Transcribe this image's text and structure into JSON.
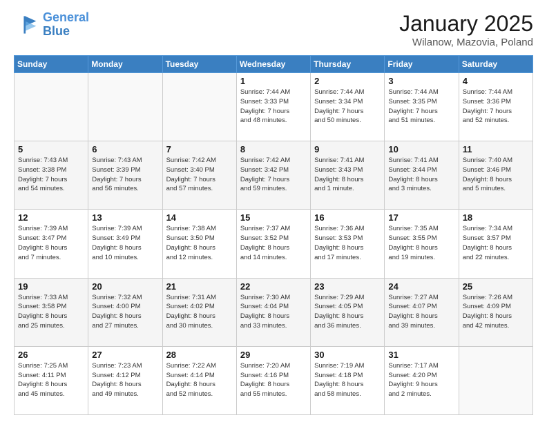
{
  "logo": {
    "line1": "General",
    "line2": "Blue"
  },
  "title": "January 2025",
  "subtitle": "Wilanow, Mazovia, Poland",
  "weekdays": [
    "Sunday",
    "Monday",
    "Tuesday",
    "Wednesday",
    "Thursday",
    "Friday",
    "Saturday"
  ],
  "weeks": [
    [
      {
        "day": "",
        "info": ""
      },
      {
        "day": "",
        "info": ""
      },
      {
        "day": "",
        "info": ""
      },
      {
        "day": "1",
        "info": "Sunrise: 7:44 AM\nSunset: 3:33 PM\nDaylight: 7 hours\nand 48 minutes."
      },
      {
        "day": "2",
        "info": "Sunrise: 7:44 AM\nSunset: 3:34 PM\nDaylight: 7 hours\nand 50 minutes."
      },
      {
        "day": "3",
        "info": "Sunrise: 7:44 AM\nSunset: 3:35 PM\nDaylight: 7 hours\nand 51 minutes."
      },
      {
        "day": "4",
        "info": "Sunrise: 7:44 AM\nSunset: 3:36 PM\nDaylight: 7 hours\nand 52 minutes."
      }
    ],
    [
      {
        "day": "5",
        "info": "Sunrise: 7:43 AM\nSunset: 3:38 PM\nDaylight: 7 hours\nand 54 minutes."
      },
      {
        "day": "6",
        "info": "Sunrise: 7:43 AM\nSunset: 3:39 PM\nDaylight: 7 hours\nand 56 minutes."
      },
      {
        "day": "7",
        "info": "Sunrise: 7:42 AM\nSunset: 3:40 PM\nDaylight: 7 hours\nand 57 minutes."
      },
      {
        "day": "8",
        "info": "Sunrise: 7:42 AM\nSunset: 3:42 PM\nDaylight: 7 hours\nand 59 minutes."
      },
      {
        "day": "9",
        "info": "Sunrise: 7:41 AM\nSunset: 3:43 PM\nDaylight: 8 hours\nand 1 minute."
      },
      {
        "day": "10",
        "info": "Sunrise: 7:41 AM\nSunset: 3:44 PM\nDaylight: 8 hours\nand 3 minutes."
      },
      {
        "day": "11",
        "info": "Sunrise: 7:40 AM\nSunset: 3:46 PM\nDaylight: 8 hours\nand 5 minutes."
      }
    ],
    [
      {
        "day": "12",
        "info": "Sunrise: 7:39 AM\nSunset: 3:47 PM\nDaylight: 8 hours\nand 7 minutes."
      },
      {
        "day": "13",
        "info": "Sunrise: 7:39 AM\nSunset: 3:49 PM\nDaylight: 8 hours\nand 10 minutes."
      },
      {
        "day": "14",
        "info": "Sunrise: 7:38 AM\nSunset: 3:50 PM\nDaylight: 8 hours\nand 12 minutes."
      },
      {
        "day": "15",
        "info": "Sunrise: 7:37 AM\nSunset: 3:52 PM\nDaylight: 8 hours\nand 14 minutes."
      },
      {
        "day": "16",
        "info": "Sunrise: 7:36 AM\nSunset: 3:53 PM\nDaylight: 8 hours\nand 17 minutes."
      },
      {
        "day": "17",
        "info": "Sunrise: 7:35 AM\nSunset: 3:55 PM\nDaylight: 8 hours\nand 19 minutes."
      },
      {
        "day": "18",
        "info": "Sunrise: 7:34 AM\nSunset: 3:57 PM\nDaylight: 8 hours\nand 22 minutes."
      }
    ],
    [
      {
        "day": "19",
        "info": "Sunrise: 7:33 AM\nSunset: 3:58 PM\nDaylight: 8 hours\nand 25 minutes."
      },
      {
        "day": "20",
        "info": "Sunrise: 7:32 AM\nSunset: 4:00 PM\nDaylight: 8 hours\nand 27 minutes."
      },
      {
        "day": "21",
        "info": "Sunrise: 7:31 AM\nSunset: 4:02 PM\nDaylight: 8 hours\nand 30 minutes."
      },
      {
        "day": "22",
        "info": "Sunrise: 7:30 AM\nSunset: 4:04 PM\nDaylight: 8 hours\nand 33 minutes."
      },
      {
        "day": "23",
        "info": "Sunrise: 7:29 AM\nSunset: 4:05 PM\nDaylight: 8 hours\nand 36 minutes."
      },
      {
        "day": "24",
        "info": "Sunrise: 7:27 AM\nSunset: 4:07 PM\nDaylight: 8 hours\nand 39 minutes."
      },
      {
        "day": "25",
        "info": "Sunrise: 7:26 AM\nSunset: 4:09 PM\nDaylight: 8 hours\nand 42 minutes."
      }
    ],
    [
      {
        "day": "26",
        "info": "Sunrise: 7:25 AM\nSunset: 4:11 PM\nDaylight: 8 hours\nand 45 minutes."
      },
      {
        "day": "27",
        "info": "Sunrise: 7:23 AM\nSunset: 4:12 PM\nDaylight: 8 hours\nand 49 minutes."
      },
      {
        "day": "28",
        "info": "Sunrise: 7:22 AM\nSunset: 4:14 PM\nDaylight: 8 hours\nand 52 minutes."
      },
      {
        "day": "29",
        "info": "Sunrise: 7:20 AM\nSunset: 4:16 PM\nDaylight: 8 hours\nand 55 minutes."
      },
      {
        "day": "30",
        "info": "Sunrise: 7:19 AM\nSunset: 4:18 PM\nDaylight: 8 hours\nand 58 minutes."
      },
      {
        "day": "31",
        "info": "Sunrise: 7:17 AM\nSunset: 4:20 PM\nDaylight: 9 hours\nand 2 minutes."
      },
      {
        "day": "",
        "info": ""
      }
    ]
  ]
}
